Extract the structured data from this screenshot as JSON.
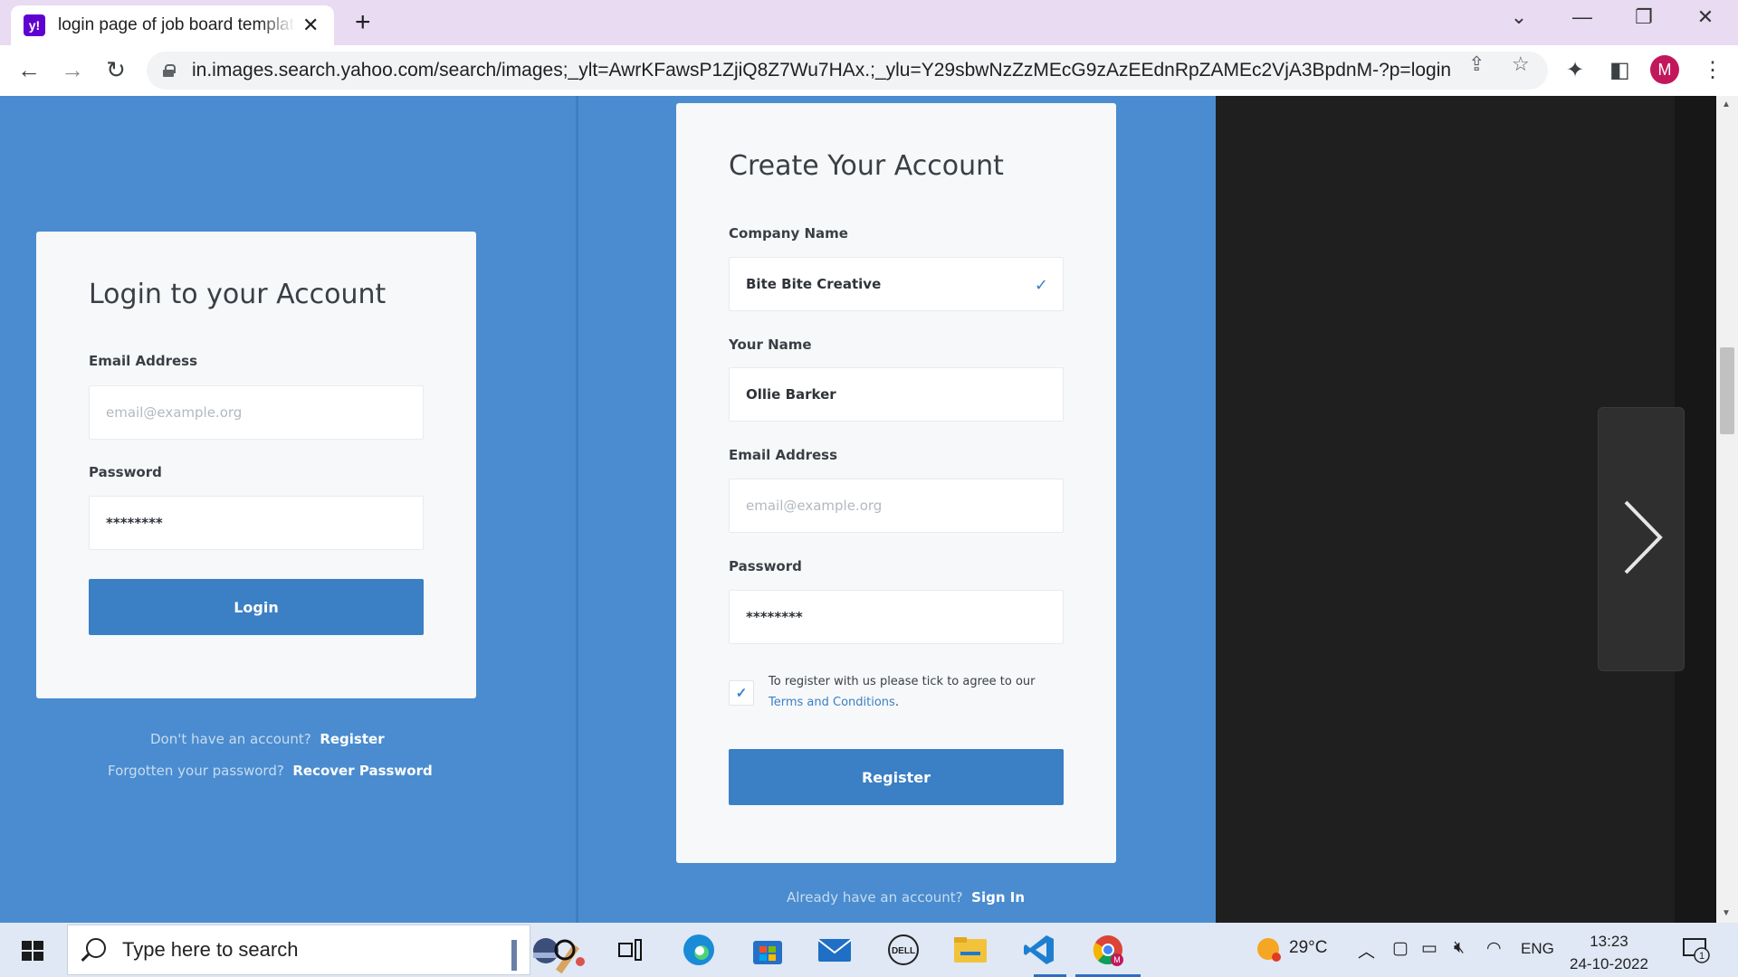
{
  "browser": {
    "tab_title": "login page of job board template",
    "tab_favicon": "y!",
    "tab_close": "✕",
    "new_tab": "+",
    "url": "in.images.search.yahoo.com/search/images;_ylt=AwrKFawsP1ZjiQ8Z7Wu7HAx.;_ylu=Y29sbwNzZzMEcG9zAzEEdnRpZAMEc2VjA3BpdnM-?p=login+p...",
    "profile_initial": "M",
    "icons": [
      "back-icon",
      "forward-icon",
      "reload-icon",
      "lock-icon",
      "share-icon",
      "star-icon",
      "extensions-icon",
      "sidepanel-icon",
      "menu-icon"
    ]
  },
  "login": {
    "title": "Login to your Account",
    "email_label": "Email Address",
    "email_placeholder": "email@example.org",
    "password_label": "Password",
    "password_value": "********",
    "button": "Login",
    "no_account_text": "Don't have an account?",
    "register_link": "Register",
    "forgot_text": "Forgotten your password?",
    "recover_link": "Recover Password"
  },
  "register": {
    "title": "Create Your Account",
    "company_label": "Company Name",
    "company_value": "Bite Bite Creative",
    "name_label": "Your Name",
    "name_value": "Ollie Barker",
    "email_label": "Email Address",
    "email_placeholder": "email@example.org",
    "password_label": "Password",
    "password_value": "********",
    "terms_text": "To register with us please tick to agree to our",
    "terms_link": "Terms and Conditions",
    "terms_period": ".",
    "button": "Register",
    "have_account_text": "Already have an account?",
    "signin_link": "Sign In"
  },
  "taskbar": {
    "search_placeholder": "Type here to search",
    "weather": "29°C",
    "language": "ENG",
    "time": "13:23",
    "date": "24-10-2022",
    "notification_count": "1"
  },
  "colors": {
    "page_blue": "#4a8ccf",
    "button_blue": "#3b7fc4",
    "tabstrip": "#e8dbf2"
  }
}
